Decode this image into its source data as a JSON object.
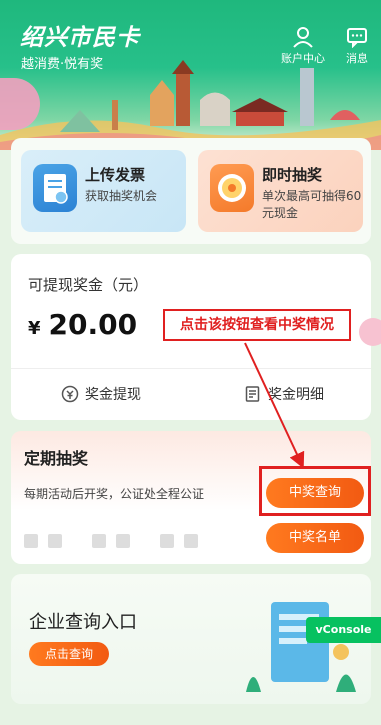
{
  "header": {
    "title": "绍兴市民卡",
    "subtitle": "越消费·悦有奖",
    "account_label": "账户中心",
    "message_label": "消息"
  },
  "tiles": [
    {
      "title": "上传发票",
      "desc": "获取抽奖机会"
    },
    {
      "title": "即时抽奖",
      "desc": "单次最高可抽得60元现金"
    }
  ],
  "prize": {
    "label": "可提现奖金（元）",
    "currency": "¥",
    "amount": "20.00",
    "withdraw_label": "奖金提现",
    "detail_label": "奖金明细"
  },
  "annotation": {
    "callout_text": "点击该按钮查看中奖情况",
    "color": "#e02020"
  },
  "regular_draw": {
    "title": "定期抽奖",
    "desc": "每期活动后开奖，公证处全程公证",
    "query_button": "中奖查询",
    "list_button": "中奖名单"
  },
  "enterprise": {
    "title": "企业查询入口",
    "button": "点击查询"
  },
  "debug": {
    "vconsole_label": "vConsole"
  },
  "colors": {
    "brand_green": "#1fb87d",
    "accent_orange": "#f25a12"
  }
}
